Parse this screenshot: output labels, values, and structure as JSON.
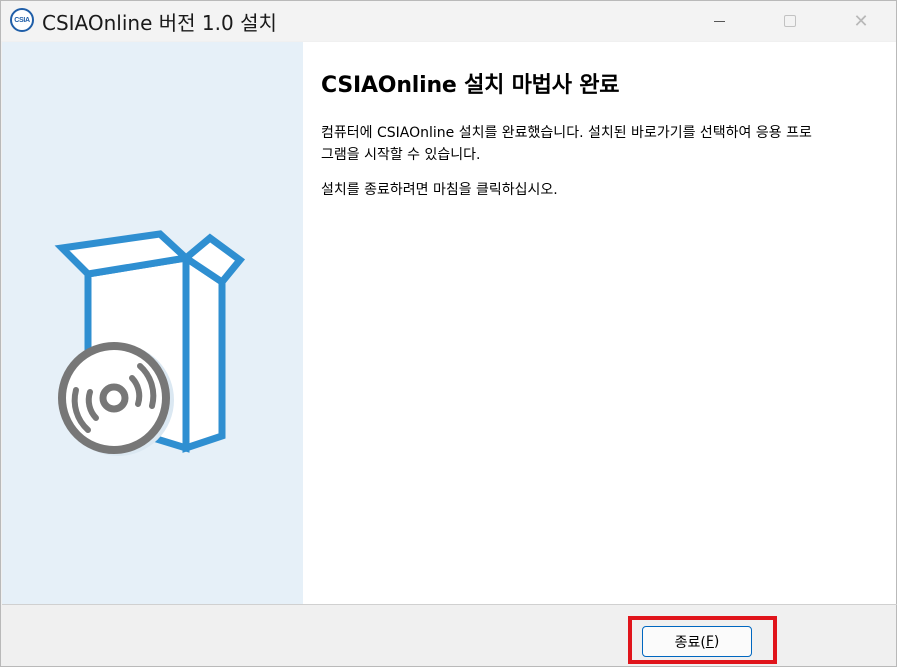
{
  "window": {
    "title": "CSIAOnline 버전 1.0 설치",
    "app_icon_text": "CSIA",
    "controls": [
      "minimize-icon",
      "maximize-icon",
      "close-icon"
    ]
  },
  "banner": {
    "illustration": "software-box-with-disc"
  },
  "content": {
    "heading": "CSIAOnline 설치 마법사 완료",
    "paragraph1_line1": "컴퓨터에 CSIAOnline 설치를 완료했습니다. 설치된 바로가기를 선택하여 응용 프로",
    "paragraph1_line2": "그램을 시작할 수 있습니다.",
    "paragraph2": "설치를 종료하려면 마침을 클릭하십시오."
  },
  "footer": {
    "finish_label": "종료(",
    "finish_accel": "F",
    "finish_label_end": ")"
  },
  "colors": {
    "accent": "#0067c0",
    "banner_bg": "#e6f0f8",
    "box_blue": "#2f8fd1",
    "disc_gray": "#777777",
    "highlight": "#e0141b"
  }
}
